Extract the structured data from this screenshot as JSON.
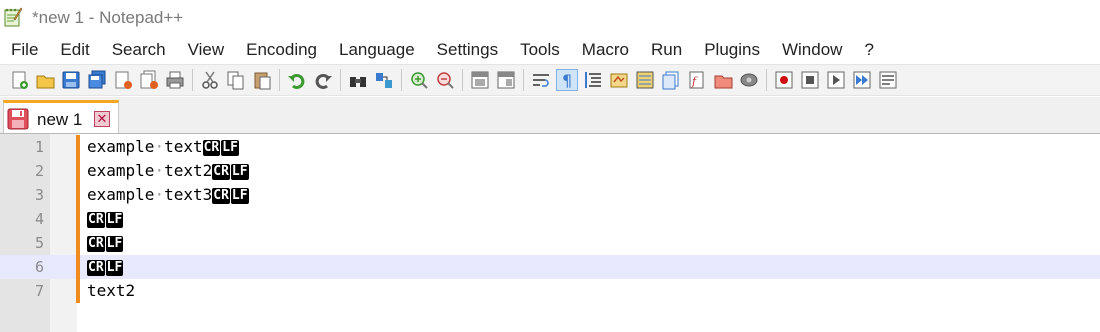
{
  "window": {
    "title": "*new 1 - Notepad++"
  },
  "menu": [
    "File",
    "Edit",
    "Search",
    "View",
    "Encoding",
    "Language",
    "Settings",
    "Tools",
    "Macro",
    "Run",
    "Plugins",
    "Window",
    "?"
  ],
  "toolbar": {
    "groups": [
      [
        "new-file-icon",
        "open-file-icon",
        "save-icon",
        "save-all-icon",
        "close-icon",
        "close-all-icon",
        "print-icon"
      ],
      [
        "cut-icon",
        "copy-icon",
        "paste-icon"
      ],
      [
        "undo-icon",
        "redo-icon"
      ],
      [
        "find-icon",
        "replace-icon"
      ],
      [
        "zoom-in-icon",
        "zoom-out-icon"
      ],
      [
        "sync-vertical-icon",
        "sync-horizontal-icon"
      ],
      [
        "word-wrap-icon",
        "show-all-characters-icon",
        "indent-guide-icon",
        "user-language-icon",
        "document-map-icon",
        "document-list-icon",
        "function-list-icon",
        "folder-as-workspace-icon",
        "monitoring-icon"
      ],
      [
        "record-macro-icon",
        "stop-recording-icon",
        "playback-macro-icon",
        "run-macro-multiple-icon",
        "save-macro-icon"
      ]
    ],
    "active": "show-all-characters-icon"
  },
  "tabs": [
    {
      "label": "new 1",
      "icon": "unsaved-file-icon",
      "close_icon": "close-tab-icon"
    }
  ],
  "editor": {
    "current_line": 6,
    "eol_markers": [
      "CR",
      "LF"
    ],
    "whitespace_marker": "·",
    "lines": [
      {
        "num": "1",
        "segments": [
          "example",
          "text"
        ],
        "eol": true
      },
      {
        "num": "2",
        "segments": [
          "example",
          "text2"
        ],
        "eol": true
      },
      {
        "num": "3",
        "segments": [
          "example",
          "text3"
        ],
        "eol": true
      },
      {
        "num": "4",
        "segments": [],
        "eol": true
      },
      {
        "num": "5",
        "segments": [],
        "eol": true
      },
      {
        "num": "6",
        "segments": [],
        "eol": true
      },
      {
        "num": "7",
        "segments": [
          "text2"
        ],
        "eol": false
      }
    ]
  },
  "colors": {
    "change_bar": "#f08c1e",
    "current_line": "#e8e8ff",
    "tab_accent": "#f5a623"
  }
}
